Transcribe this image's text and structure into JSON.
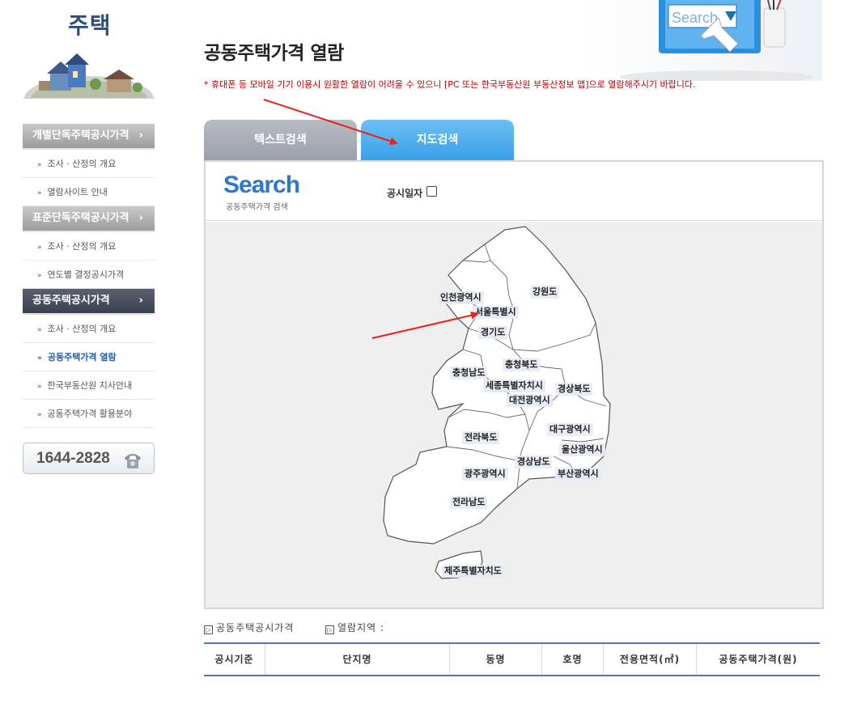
{
  "sidebar": {
    "title": "주택",
    "menus": [
      {
        "label": "개별단독주택공시가격",
        "items": [
          "조사 · 산정의 개요",
          "열람사이트 안내"
        ]
      },
      {
        "label": "표준단독주택공시가격",
        "items": [
          "조사 · 산정의 개요",
          "연도별 결정공시가격"
        ]
      },
      {
        "label": "공동주택공시가격",
        "items": [
          "조사 · 산정의 개요",
          "공동주택가격 열람",
          "한국부동산원 지사안내",
          "공동주택가격 활용분야"
        ]
      }
    ],
    "chevron": "›",
    "bullet": "»",
    "phone": "1644-2828",
    "phone_icon": "telephone-icon"
  },
  "hero": {
    "search_text": "Search"
  },
  "page": {
    "title": "공동주택가격 열람",
    "notice": "* 휴대폰 등 모바일 기기 이용시 원활한 열람이 어려울 수 있으니 [PC 또는 한국부동산원 부동산정보 앱]으로 열람해주시기 바랍니다."
  },
  "tabs": {
    "text_search": "텍스트검색",
    "map_search": "지도검색"
  },
  "search_panel": {
    "logo": "Search",
    "sub": "공동주택가격 검색",
    "date_label": "공시일자"
  },
  "map": {
    "regions": {
      "incheon": "인천광역시",
      "seoul": "서울특별시",
      "gangwon": "강원도",
      "gyeonggi": "경기도",
      "chungbuk": "충청북도",
      "chungnam": "충청남도",
      "sejong": "세종특별자치시",
      "gyeongbuk": "경상북도",
      "daejeon": "대전광역시",
      "daegu": "대구광역시",
      "jeonbuk": "전라북도",
      "ulsan": "울산광역시",
      "gyeongnam": "경상남도",
      "gwangju": "광주광역시",
      "busan": "부산광역시",
      "jeonnam": "전라남도",
      "jeju": "제주특별자치도"
    }
  },
  "info": {
    "price_label": "공동주택공시가격",
    "region_label": "열람지역 :",
    "marker": "▷"
  },
  "table": {
    "headers": [
      "공시기준",
      "단지명",
      "동명",
      "호명",
      "전용면적(㎡)",
      "공동주택가격(원)"
    ]
  },
  "colors": {
    "accent_blue": "#3a9ee8",
    "notice_red": "#c00000",
    "table_border": "#4a78bf",
    "arrow_red": "#e8231e"
  }
}
